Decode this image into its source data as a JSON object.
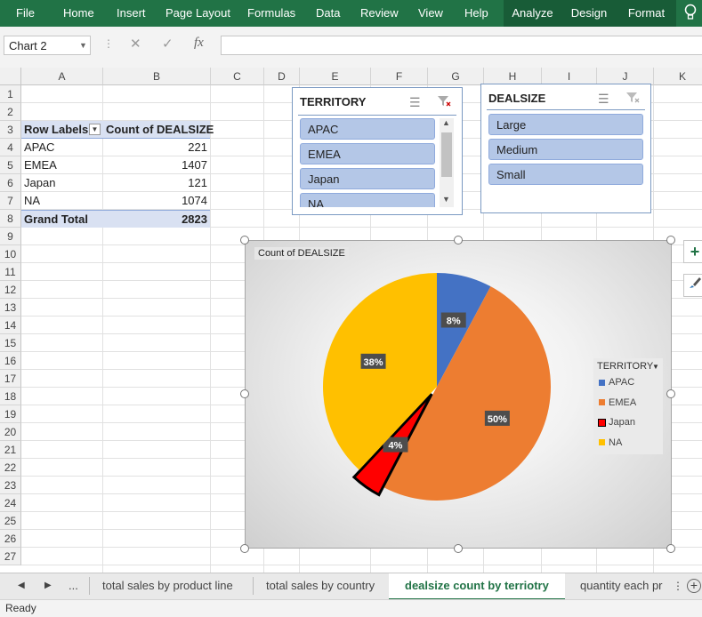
{
  "ribbon": {
    "tabs": [
      "File",
      "Home",
      "Insert",
      "Page Layout",
      "Formulas",
      "Data",
      "Review",
      "View",
      "Help",
      "Analyze",
      "Design",
      "Format"
    ]
  },
  "formula_bar": {
    "name_box": "Chart 2",
    "fx": "fx"
  },
  "columns": [
    "A",
    "B",
    "C",
    "D",
    "E",
    "F",
    "G",
    "H",
    "I",
    "J",
    "K"
  ],
  "rows": [
    "1",
    "2",
    "3",
    "4",
    "5",
    "6",
    "7",
    "8",
    "9",
    "10",
    "11",
    "12",
    "13",
    "14",
    "15",
    "16",
    "17",
    "18",
    "19",
    "20",
    "21",
    "22",
    "23",
    "24",
    "25",
    "26",
    "27"
  ],
  "pivot": {
    "header_row_labels": "Row Labels",
    "header_count": "Count of DEALSIZE",
    "rows": [
      {
        "label": "APAC",
        "value": "221"
      },
      {
        "label": "EMEA",
        "value": "1407"
      },
      {
        "label": "Japan",
        "value": "121"
      },
      {
        "label": "NA",
        "value": "1074"
      }
    ],
    "grand_total_label": "Grand Total",
    "grand_total_value": "2823"
  },
  "slicers": {
    "territory": {
      "title": "TERRITORY",
      "items": [
        "APAC",
        "EMEA",
        "Japan",
        "NA"
      ]
    },
    "dealsize": {
      "title": "DEALSIZE",
      "items": [
        "Large",
        "Medium",
        "Small"
      ]
    }
  },
  "chart_data": {
    "type": "pie",
    "title": "Count of DEALSIZE",
    "legend_title": "TERRITORY",
    "legend_position": "right",
    "categories": [
      "APAC",
      "EMEA",
      "Japan",
      "NA"
    ],
    "values": [
      221,
      1407,
      121,
      1074
    ],
    "labels": [
      "8%",
      "50%",
      "4%",
      "38%"
    ],
    "colors": [
      "#4472c4",
      "#ed7d31",
      "#ff0000",
      "#ffc000"
    ],
    "exploded": "Japan"
  },
  "sheet_tabs": {
    "items": [
      "total sales by product line",
      "total sales by country",
      "dealsize count by terriotry",
      "quantity each pr"
    ],
    "active": "dealsize count by terriotry",
    "ellipsis": "..."
  },
  "status": {
    "text": "Ready"
  }
}
